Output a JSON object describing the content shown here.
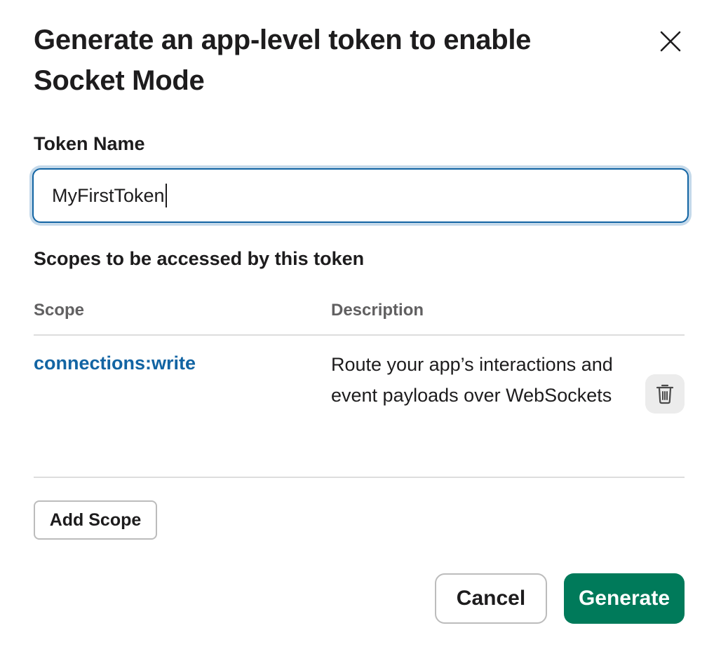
{
  "dialog": {
    "title": "Generate an app-level token to enable Socket Mode"
  },
  "token_field": {
    "label": "Token Name",
    "value": "MyFirstToken"
  },
  "scopes": {
    "section_title": "Scopes to be accessed by this token",
    "columns": {
      "scope": "Scope",
      "description": "Description"
    },
    "rows": [
      {
        "scope": "connections:write",
        "description": "Route your app’s interactions and event payloads over WebSockets"
      }
    ],
    "add_label": "Add Scope"
  },
  "footer": {
    "cancel_label": "Cancel",
    "generate_label": "Generate"
  },
  "colors": {
    "link": "#1264a3",
    "primary": "#007a5a",
    "focus_ring": "#c4d9ea"
  },
  "icons": {
    "close": "close-icon",
    "delete": "trash-icon"
  }
}
